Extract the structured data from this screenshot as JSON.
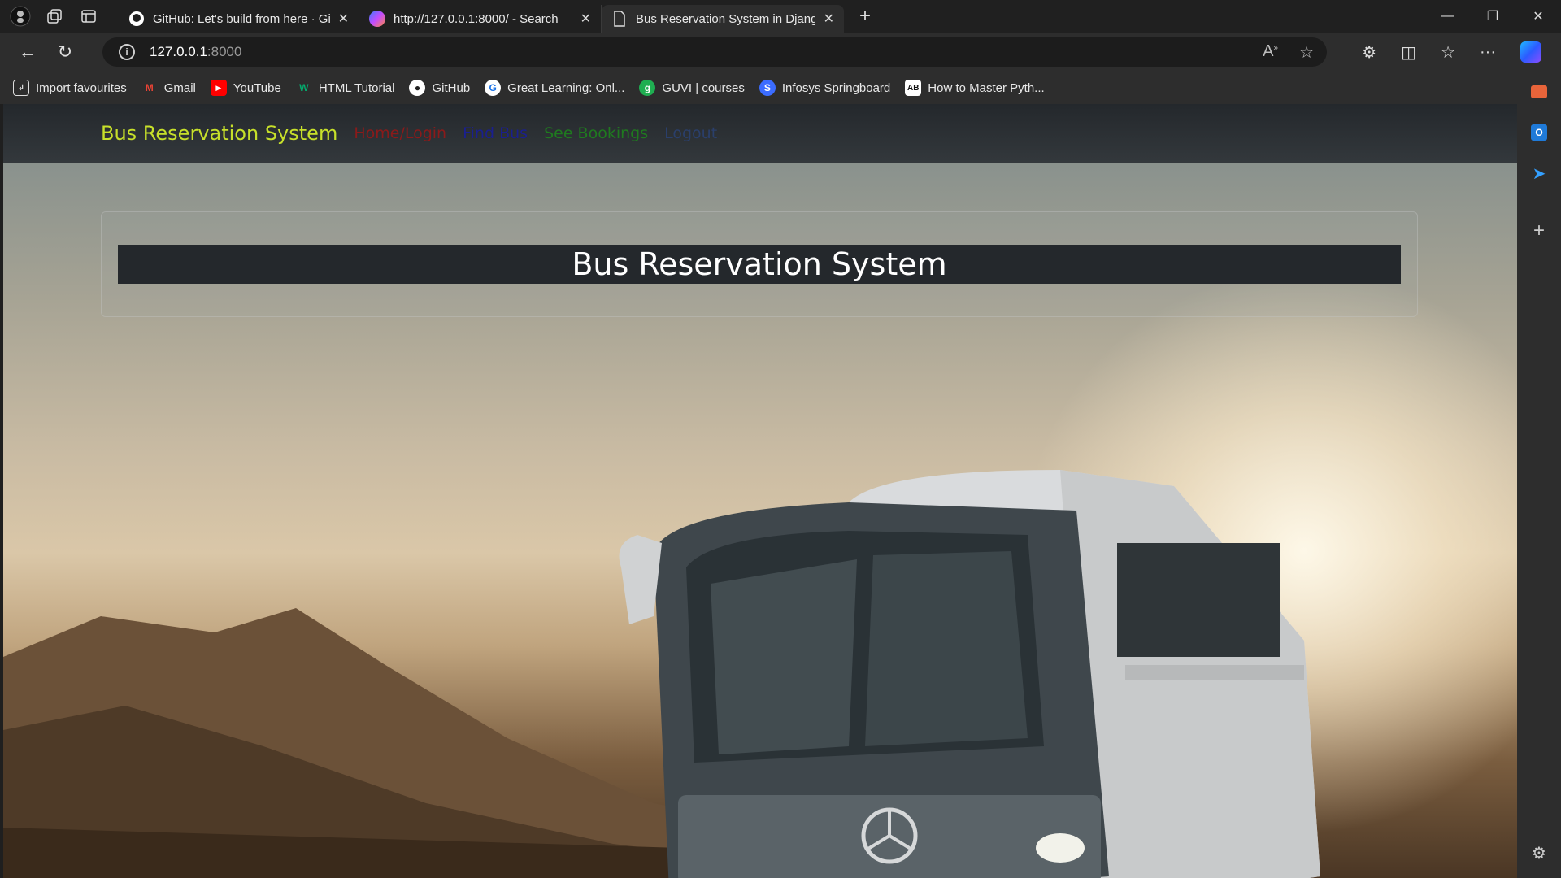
{
  "browser": {
    "tabs": [
      {
        "title": "GitHub: Let's build from here · Gi",
        "favicon": "github-icon"
      },
      {
        "title": "http://127.0.0.1:8000/ - Search",
        "favicon": "bing-search-icon"
      },
      {
        "title": "Bus Reservation System in Djang",
        "favicon": "page-icon",
        "active": true
      }
    ],
    "address": {
      "host": "127.0.0.1",
      "port": ":8000"
    },
    "bookmarks": [
      {
        "label": "Import favourites",
        "icon": "import-icon"
      },
      {
        "label": "Gmail",
        "icon": "gmail-icon"
      },
      {
        "label": "YouTube",
        "icon": "youtube-icon"
      },
      {
        "label": "HTML Tutorial",
        "icon": "w3schools-icon"
      },
      {
        "label": "GitHub",
        "icon": "github-icon"
      },
      {
        "label": "Great Learning: Onl...",
        "icon": "great-learning-icon"
      },
      {
        "label": "GUVI | courses",
        "icon": "guvi-icon"
      },
      {
        "label": "Infosys Springboard",
        "icon": "infosys-icon"
      },
      {
        "label": "How to Master Pyth...",
        "icon": "ab-icon"
      }
    ]
  },
  "site": {
    "brand": "Bus Reservation System",
    "nav": [
      {
        "label": "Home/Login",
        "color": "#8b1a1a"
      },
      {
        "label": "Find Bus",
        "color": "#1a1f8f"
      },
      {
        "label": "See Bookings",
        "color": "#1f7a1f"
      },
      {
        "label": "Logout",
        "color": "#2a3f6b"
      }
    ],
    "headline": "Bus Reservation System",
    "colors": {
      "brand": "#c7e02a",
      "navbar": "#2b3034",
      "headline_bg": "#24282c"
    }
  }
}
